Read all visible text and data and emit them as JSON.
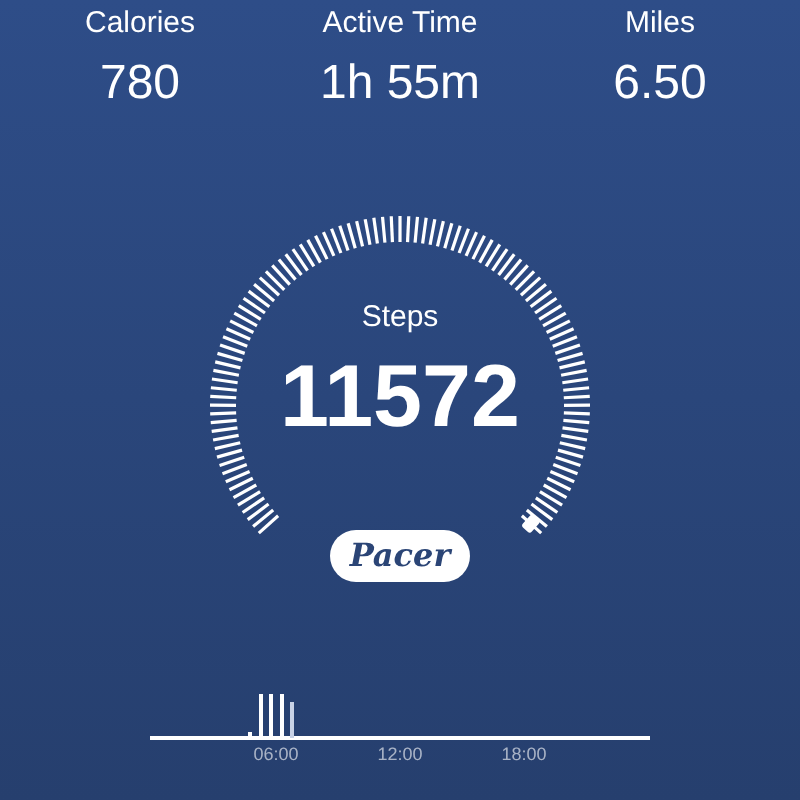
{
  "stats": [
    {
      "label": "Calories",
      "value": "780"
    },
    {
      "label": "Active Time",
      "value": "1h 55m"
    },
    {
      "label": "Miles",
      "value": "6.50"
    }
  ],
  "gauge": {
    "label": "Steps",
    "value": "11572"
  },
  "brand_button": "Pacer",
  "activity_chart": {
    "time_labels": [
      "06:00",
      "12:00",
      "18:00"
    ]
  }
}
